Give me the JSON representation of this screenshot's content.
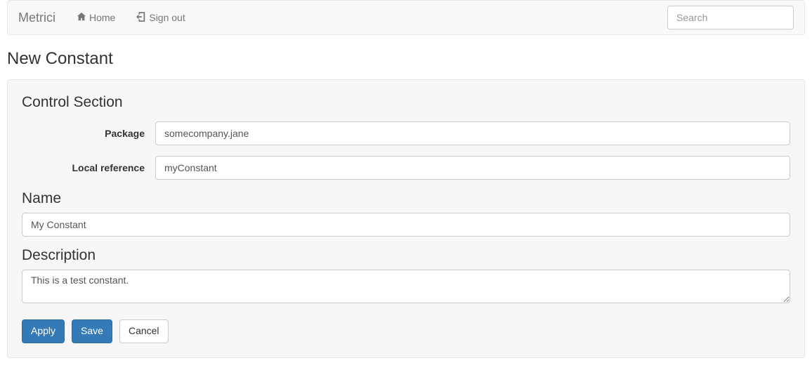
{
  "navbar": {
    "brand": "Metrici",
    "home_label": "Home",
    "signout_label": "Sign out",
    "search_placeholder": "Search"
  },
  "page_title": "New Constant",
  "form": {
    "control_section_title": "Control Section",
    "package_label": "Package",
    "package_value": "somecompany.jane",
    "localref_label": "Local reference",
    "localref_value": "myConstant",
    "name_label": "Name",
    "name_value": "My Constant",
    "description_label": "Description",
    "description_value": "This is a test constant."
  },
  "buttons": {
    "apply": "Apply",
    "save": "Save",
    "cancel": "Cancel"
  }
}
